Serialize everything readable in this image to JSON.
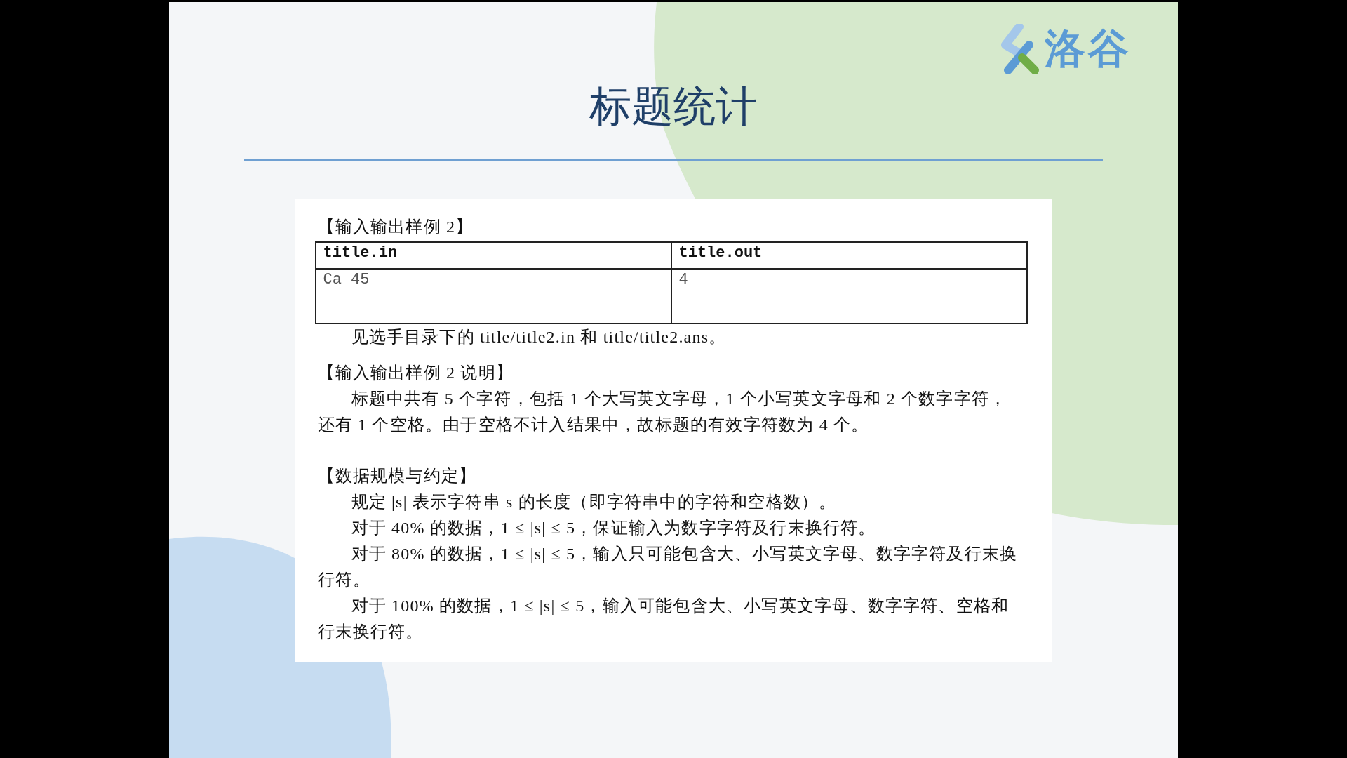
{
  "logo": {
    "text": "洛谷"
  },
  "title": "标题统计",
  "sections": [
    {
      "heading": "【输入输出样例 2】",
      "table": {
        "columns": [
          "title.in",
          "title.out"
        ],
        "rows": [
          [
            "Ca 45",
            "4"
          ]
        ]
      },
      "paragraphs": [
        "见选手目录下的 title/title2.in 和 title/title2.ans。"
      ]
    },
    {
      "heading": "【输入输出样例 2 说明】",
      "paragraphs": [
        "标题中共有 5 个字符，包括 1 个大写英文字母，1 个小写英文字母和 2 个数字字符，还有 1 个空格。由于空格不计入结果中，故标题的有效字符数为 4 个。"
      ]
    },
    {
      "heading": "【数据规模与约定】",
      "paragraphs": [
        "规定 |s| 表示字符串 s 的长度（即字符串中的字符和空格数）。",
        "对于 40% 的数据，1 ≤ |s| ≤ 5，保证输入为数字字符及行末换行符。",
        "对于 80% 的数据，1 ≤ |s| ≤ 5，输入只可能包含大、小写英文字母、数字字符及行末换行符。",
        "对于 100% 的数据，1 ≤ |s| ≤ 5，输入可能包含大、小写英文字母、数字字符、空格和行末换行符。"
      ]
    }
  ]
}
